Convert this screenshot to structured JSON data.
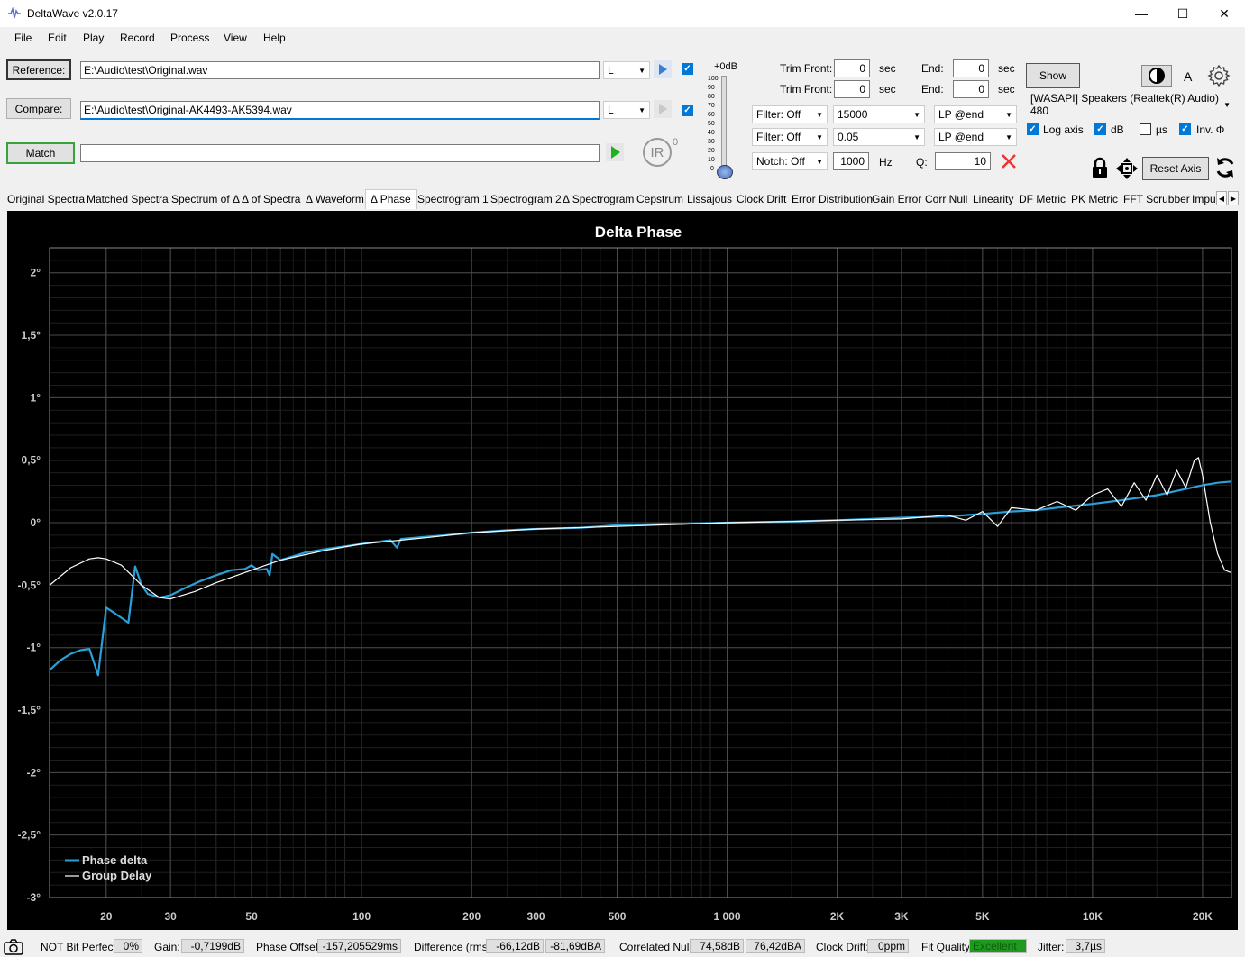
{
  "window": {
    "title": "DeltaWave v2.0.17",
    "minimize": "—",
    "maximize": "☐",
    "close": "✕"
  },
  "menu": [
    "File",
    "Edit",
    "Play",
    "Record",
    "Process",
    "View",
    "Help"
  ],
  "reference": {
    "button": "Reference:",
    "path": "E:\\Audio\\test\\Original.wav",
    "channel": "L"
  },
  "compare": {
    "button": "Compare:",
    "path": "E:\\Audio\\test\\Original-AK4493-AK5394.wav",
    "channel": "L"
  },
  "match": {
    "button": "Match",
    "progress": 0
  },
  "ir": {
    "label": "IR",
    "sup": "0"
  },
  "level": {
    "label": "+0dB",
    "ticks": [
      "100",
      "90",
      "80",
      "70",
      "60",
      "50",
      "40",
      "30",
      "20",
      "10",
      "0"
    ]
  },
  "trim": [
    {
      "front_label": "Trim Front:",
      "front": "0",
      "unit": "sec",
      "end_label": "End:",
      "end": "0",
      "end_unit": "sec"
    },
    {
      "front_label": "Trim Front:",
      "front": "0",
      "unit": "sec",
      "end_label": "End:",
      "end": "0",
      "end_unit": "sec"
    }
  ],
  "filters": [
    {
      "filter": "Filter: Off",
      "value": "15000",
      "mode": "LP @end"
    },
    {
      "filter": "Filter: Off",
      "value": "0.05",
      "mode": "LP @end"
    }
  ],
  "notch": {
    "label": "Notch: Off",
    "freq": "1000",
    "unit": "Hz",
    "q_label": "Q:",
    "q": "10"
  },
  "show_button": "Show",
  "theme_letter": "A",
  "device": "[WASAPI] Speakers (Realtek(R) Audio) 480",
  "options": [
    {
      "label": "Log axis",
      "checked": true
    },
    {
      "label": "dB",
      "checked": true
    },
    {
      "label": "µs",
      "checked": false
    },
    {
      "label": "Inv. Φ",
      "checked": true
    }
  ],
  "reset_axis": "Reset Axis",
  "tabs": [
    "Original Spectra",
    "Matched Spectra",
    "Spectrum of Δ",
    "Δ of Spectra",
    "Δ Waveform",
    "Δ Phase",
    "Spectrogram 1",
    "Spectrogram 2",
    "Δ Spectrogram",
    "Cepstrum",
    "Lissajous",
    "Clock Drift",
    "Error Distribution",
    "Gain Error",
    "Corr Null",
    "Linearity",
    "DF Metric",
    "PK Metric",
    "FFT Scrubber",
    "Impu"
  ],
  "active_tab": "Δ Phase",
  "chart_data": {
    "type": "line",
    "title": "Delta Phase",
    "xscale": "log",
    "xlim": [
      14,
      24000
    ],
    "ylim": [
      -3,
      2.2
    ],
    "grid": true,
    "legend_position": "bottom-left",
    "x_tick_labels": [
      "20",
      "30",
      "50",
      "100",
      "200",
      "300",
      "500",
      "1 000",
      "2K",
      "3K",
      "5K",
      "10K",
      "20K"
    ],
    "x_ticks": [
      20,
      30,
      50,
      100,
      200,
      300,
      500,
      1000,
      2000,
      3000,
      5000,
      10000,
      20000
    ],
    "y_tick_labels": [
      "2°",
      "1,5°",
      "1°",
      "0,5°",
      "0°",
      "-0,5°",
      "-1°",
      "-1,5°",
      "-2°",
      "-2,5°",
      "-3°"
    ],
    "y_ticks": [
      2,
      1.5,
      1,
      0.5,
      0,
      -0.5,
      -1,
      -1.5,
      -2,
      -2.5,
      -3
    ],
    "series": [
      {
        "name": "Phase delta",
        "color": "#2a9fd8",
        "x": [
          14,
          15,
          16,
          17,
          18,
          19,
          20,
          21,
          23,
          24,
          25,
          26,
          28,
          30,
          33,
          36,
          40,
          44,
          48,
          50,
          52,
          55,
          56,
          57,
          60,
          70,
          80,
          100,
          120,
          125,
          128,
          140,
          170,
          200,
          250,
          300,
          400,
          500,
          700,
          1000,
          1500,
          2000,
          3000,
          4000,
          5000,
          6000,
          7000,
          8000,
          10000,
          12000,
          15000,
          18000,
          20000,
          22000,
          24000
        ],
        "y": [
          -1.18,
          -1.1,
          -1.05,
          -1.02,
          -1.01,
          -1.22,
          -0.68,
          -0.72,
          -0.8,
          -0.35,
          -0.5,
          -0.57,
          -0.6,
          -0.58,
          -0.52,
          -0.47,
          -0.42,
          -0.38,
          -0.37,
          -0.34,
          -0.38,
          -0.37,
          -0.42,
          -0.25,
          -0.3,
          -0.24,
          -0.21,
          -0.17,
          -0.14,
          -0.2,
          -0.13,
          -0.12,
          -0.1,
          -0.08,
          -0.06,
          -0.05,
          -0.04,
          -0.02,
          -0.01,
          0.0,
          0.01,
          0.02,
          0.04,
          0.05,
          0.07,
          0.09,
          0.1,
          0.12,
          0.15,
          0.18,
          0.22,
          0.27,
          0.3,
          0.32,
          0.33
        ]
      },
      {
        "name": "Group Delay",
        "color": "#ffffff",
        "x": [
          14,
          16,
          18,
          19,
          20,
          22,
          25,
          28,
          30,
          35,
          40,
          50,
          60,
          80,
          100,
          150,
          200,
          300,
          500,
          1000,
          1500,
          2000,
          3000,
          4000,
          4500,
          5000,
          5500,
          6000,
          7000,
          8000,
          9000,
          10000,
          11000,
          12000,
          13000,
          14000,
          15000,
          16000,
          17000,
          18000,
          19000,
          19500,
          20000,
          21000,
          22000,
          23000,
          24000
        ],
        "y": [
          -0.5,
          -0.36,
          -0.29,
          -0.28,
          -0.29,
          -0.34,
          -0.5,
          -0.6,
          -0.61,
          -0.55,
          -0.48,
          -0.38,
          -0.3,
          -0.22,
          -0.17,
          -0.12,
          -0.08,
          -0.05,
          -0.03,
          0.0,
          0.01,
          0.02,
          0.03,
          0.06,
          0.02,
          0.09,
          -0.03,
          0.12,
          0.1,
          0.17,
          0.1,
          0.22,
          0.27,
          0.13,
          0.32,
          0.18,
          0.38,
          0.22,
          0.42,
          0.28,
          0.5,
          0.52,
          0.38,
          0.0,
          -0.25,
          -0.38,
          -0.4
        ]
      }
    ]
  },
  "status": {
    "bit_perfect": "NOT Bit Perfect",
    "bit_pct": "0%",
    "gain_label": "Gain:",
    "gain": "-0,7199dB",
    "phase_label": "Phase Offset:",
    "phase": "-157,205529ms",
    "diff_label": "Difference (rms):",
    "diff_db": "-66,12dB",
    "diff_dba": "-81,69dBA",
    "null_label": "Correlated Null:",
    "null_db": "74,58dB",
    "null_dba": "76,42dBA",
    "drift_label": "Clock Drift:",
    "drift": "0ppm",
    "fit_label": "Fit Quality:",
    "fit": "Excellent",
    "jitter_label": "Jitter:",
    "jitter": "3,7µs"
  }
}
